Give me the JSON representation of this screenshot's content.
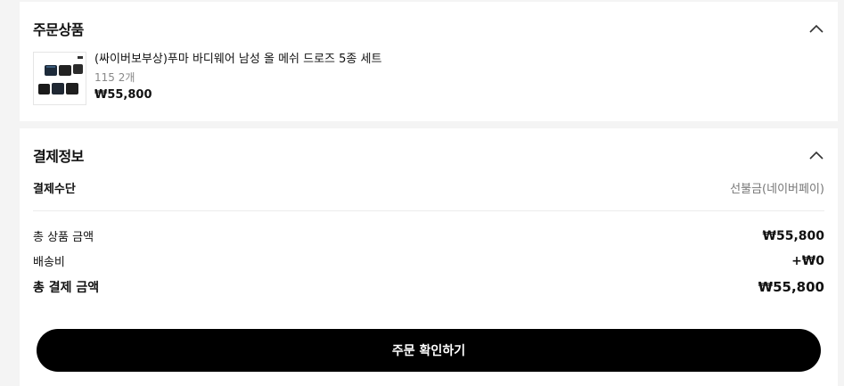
{
  "order_items": {
    "title": "주문상품",
    "items": [
      {
        "name": "(싸이버보부상)푸마 바디웨어 남성 올 메쉬 드로즈 5종 세트",
        "option": "115 2개",
        "price": "₩55,800",
        "thumbnail_icon": "boxer-briefs-set-thumbnail"
      }
    ]
  },
  "payment": {
    "title": "결제정보",
    "method_label": "결제수단",
    "method_value": "선불금(네이버페이)",
    "product_total_label": "총 상품 금액",
    "product_total_value": "₩55,800",
    "shipping_label": "배송비",
    "shipping_value": "+₩0",
    "grand_total_label": "총 결제 금액",
    "grand_total_value": "₩55,800"
  },
  "confirm_button": "주문 확인하기",
  "colors": {
    "button_bg": "#000000",
    "background": "#f4f4f4"
  }
}
